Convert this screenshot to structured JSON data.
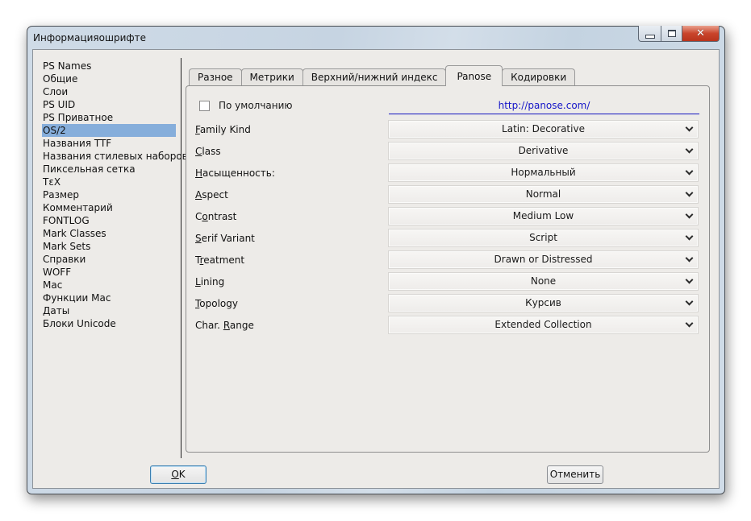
{
  "window": {
    "title": "Информацияошрифте",
    "caption_buttons": [
      {
        "name": "minimize",
        "icon": "minimize-icon"
      },
      {
        "name": "maximize",
        "icon": "maximize-icon"
      },
      {
        "name": "close",
        "icon": "close-icon",
        "glyph": "✕"
      }
    ]
  },
  "sidebar": {
    "selected": "OS/2",
    "items": [
      {
        "label": "PS Names"
      },
      {
        "label": "Общие"
      },
      {
        "label": "Слои"
      },
      {
        "label": "PS UID"
      },
      {
        "label": "PS Приватное"
      },
      {
        "label": "OS/2",
        "selected": true
      },
      {
        "label": "Названия TTF"
      },
      {
        "label": "Названия стилевых наборов"
      },
      {
        "label": "Пиксельная сетка"
      },
      {
        "label": "TεX"
      },
      {
        "label": "Размер"
      },
      {
        "label": "Комментарий"
      },
      {
        "label": "FONTLOG"
      },
      {
        "label": "Mark Classes"
      },
      {
        "label": "Mark Sets"
      },
      {
        "label": "Справки"
      },
      {
        "label": "WOFF"
      },
      {
        "label": "Mac"
      },
      {
        "label": "Функции Mac"
      },
      {
        "label": "Даты"
      },
      {
        "label": "Блоки Unicode"
      }
    ]
  },
  "tabs": [
    {
      "label": "Разное"
    },
    {
      "label": "Метрики"
    },
    {
      "label": "Верхний/нижний индекс"
    },
    {
      "label": "Panose",
      "active": true
    },
    {
      "label": "Кодировки"
    }
  ],
  "panose": {
    "default_checkbox": {
      "label": "По умолчанию",
      "checked": false
    },
    "link": "http://panose.com/",
    "fields": [
      {
        "label_pre": "",
        "label_u": "F",
        "label_post": "amily Kind",
        "value": "Latin: Decorative"
      },
      {
        "label_pre": "",
        "label_u": "C",
        "label_post": "lass",
        "value": "Derivative"
      },
      {
        "label_pre": "",
        "label_u": "Н",
        "label_post": "асыщенность:",
        "value": "Нормальный"
      },
      {
        "label_pre": "",
        "label_u": "A",
        "label_post": "spect",
        "value": "Normal"
      },
      {
        "label_pre": "C",
        "label_u": "o",
        "label_post": "ntrast",
        "value": "Medium Low"
      },
      {
        "label_pre": "",
        "label_u": "S",
        "label_post": "erif Variant",
        "value": "Script"
      },
      {
        "label_pre": "T",
        "label_u": "r",
        "label_post": "eatment",
        "value": "Drawn or Distressed"
      },
      {
        "label_pre": "",
        "label_u": "L",
        "label_post": "ining",
        "value": "None"
      },
      {
        "label_pre": "",
        "label_u": "T",
        "label_post": "opology",
        "value": "Курсив"
      },
      {
        "label_pre": "Char. ",
        "label_u": "R",
        "label_post": "ange",
        "value": "Extended Collection"
      }
    ]
  },
  "buttons": {
    "ok_u": "O",
    "ok_rest": "K",
    "cancel": "Отменить"
  },
  "colors": {
    "selection": "#86aedb",
    "link": "#1515c8",
    "close_button": "#c9452c"
  }
}
